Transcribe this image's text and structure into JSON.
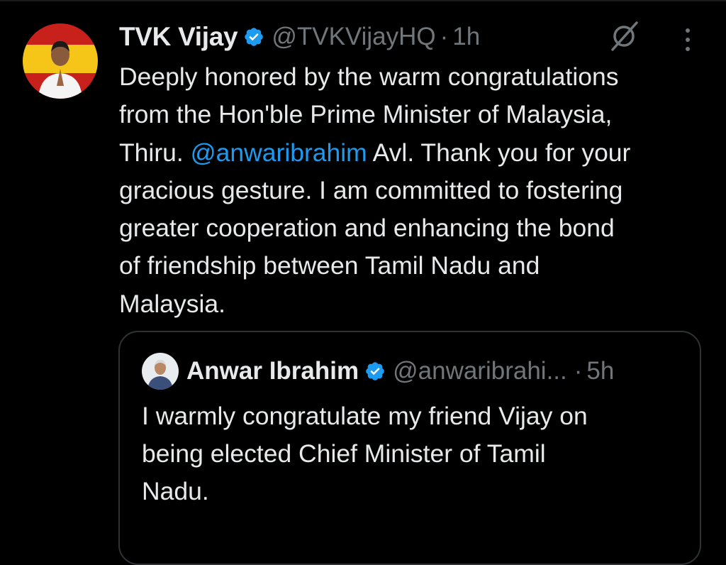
{
  "tweet": {
    "display_name": "TVK Vijay",
    "handle": "@TVKVijayHQ",
    "separator": "·",
    "time": "1h",
    "verified": true,
    "text_lines": [
      "Deeply honored by the warm congratulations",
      "from the Hon'ble Prime Minister of Malaysia,",
      "Avl. Thank you for your",
      "gracious gesture. I am committed to fostering",
      "greater cooperation and enhancing the bond",
      "of friendship between Tamil Nadu and",
      "Malaysia."
    ],
    "line3_prefix": "Thiru. ",
    "mention": "@anwaribrahim",
    "actions": {
      "grok_icon": "grok-slash-icon",
      "more_icon": "more-vertical-icon"
    }
  },
  "quoted_tweet": {
    "display_name": "Anwar Ibrahim",
    "handle": "@anwaribrahi...",
    "separator": "·",
    "time": "5h",
    "verified": true,
    "text_lines": [
      "I warmly congratulate my friend Vijay on",
      "being elected Chief Minister of Tamil",
      "Nadu."
    ]
  },
  "colors": {
    "background": "#000000",
    "text_primary": "#e7e9ea",
    "text_secondary": "#71767b",
    "link": "#1d9bf0",
    "verified_badge": "#1d9bf0",
    "border": "#2f3336",
    "avatar_red": "#c8211b",
    "avatar_yellow": "#f5c518"
  }
}
